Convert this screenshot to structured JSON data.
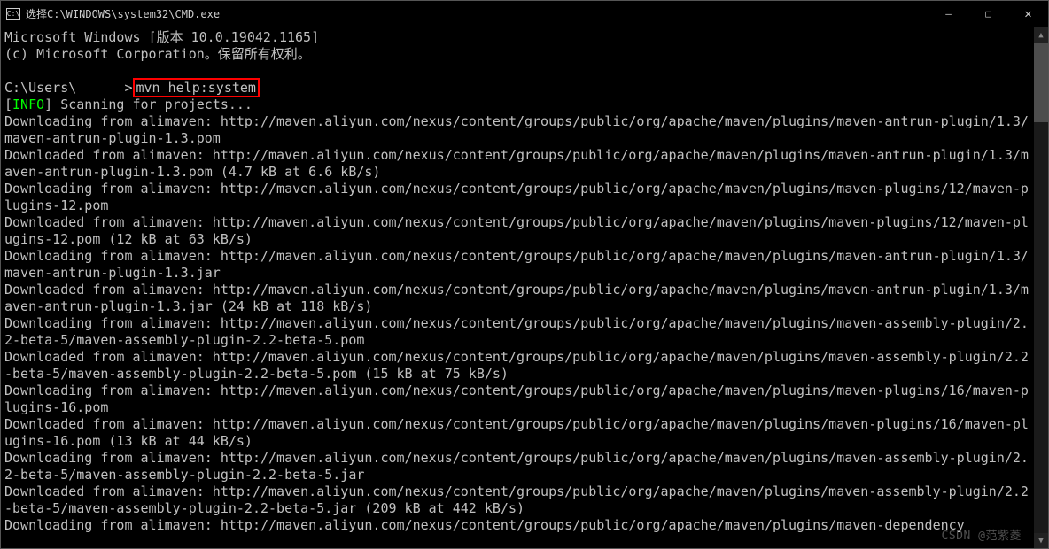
{
  "titlebar": {
    "icon": "C:\\",
    "title": "选择C:\\WINDOWS\\system32\\CMD.exe",
    "minimize": "—",
    "maximize": "□",
    "close": "✕"
  },
  "terminal": {
    "line_win": "Microsoft Windows [版本 10.0.19042.1165]",
    "line_copy": "(c) Microsoft Corporation。保留所有权利。",
    "prompt_prefix": "C:\\Users\\",
    "prompt_mid": "      >",
    "command": "mvn help:system",
    "info_open": "[",
    "info_tag": "INFO",
    "info_close": "] Scanning for projects...",
    "l1": "Downloading from alimaven: http://maven.aliyun.com/nexus/content/groups/public/org/apache/maven/plugins/maven-antrun-plugin/1.3/maven-antrun-plugin-1.3.pom",
    "l2": "Downloaded from alimaven: http://maven.aliyun.com/nexus/content/groups/public/org/apache/maven/plugins/maven-antrun-plugin/1.3/maven-antrun-plugin-1.3.pom (4.7 kB at 6.6 kB/s)",
    "l3": "Downloading from alimaven: http://maven.aliyun.com/nexus/content/groups/public/org/apache/maven/plugins/maven-plugins/12/maven-plugins-12.pom",
    "l4": "Downloaded from alimaven: http://maven.aliyun.com/nexus/content/groups/public/org/apache/maven/plugins/maven-plugins/12/maven-plugins-12.pom (12 kB at 63 kB/s)",
    "l5": "Downloading from alimaven: http://maven.aliyun.com/nexus/content/groups/public/org/apache/maven/plugins/maven-antrun-plugin/1.3/maven-antrun-plugin-1.3.jar",
    "l6": "Downloaded from alimaven: http://maven.aliyun.com/nexus/content/groups/public/org/apache/maven/plugins/maven-antrun-plugin/1.3/maven-antrun-plugin-1.3.jar (24 kB at 118 kB/s)",
    "l7": "Downloading from alimaven: http://maven.aliyun.com/nexus/content/groups/public/org/apache/maven/plugins/maven-assembly-plugin/2.2-beta-5/maven-assembly-plugin-2.2-beta-5.pom",
    "l8": "Downloaded from alimaven: http://maven.aliyun.com/nexus/content/groups/public/org/apache/maven/plugins/maven-assembly-plugin/2.2-beta-5/maven-assembly-plugin-2.2-beta-5.pom (15 kB at 75 kB/s)",
    "l9": "Downloading from alimaven: http://maven.aliyun.com/nexus/content/groups/public/org/apache/maven/plugins/maven-plugins/16/maven-plugins-16.pom",
    "l10": "Downloaded from alimaven: http://maven.aliyun.com/nexus/content/groups/public/org/apache/maven/plugins/maven-plugins/16/maven-plugins-16.pom (13 kB at 44 kB/s)",
    "l11": "Downloading from alimaven: http://maven.aliyun.com/nexus/content/groups/public/org/apache/maven/plugins/maven-assembly-plugin/2.2-beta-5/maven-assembly-plugin-2.2-beta-5.jar",
    "l12": "Downloaded from alimaven: http://maven.aliyun.com/nexus/content/groups/public/org/apache/maven/plugins/maven-assembly-plugin/2.2-beta-5/maven-assembly-plugin-2.2-beta-5.jar (209 kB at 442 kB/s)",
    "l13": "Downloading from alimaven: http://maven.aliyun.com/nexus/content/groups/public/org/apache/maven/plugins/maven-dependency"
  },
  "watermark": "CSDN @范紫菱"
}
